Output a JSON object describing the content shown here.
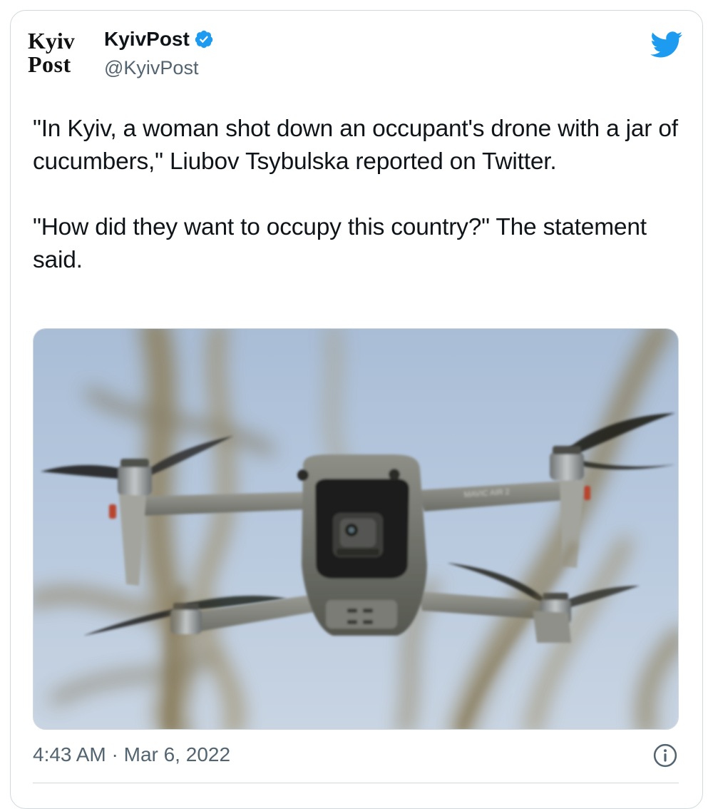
{
  "author": {
    "logo_line1": "Kyiv",
    "logo_line2": "Post",
    "display_name": "KyivPost",
    "handle": "@KyivPost",
    "verified": true
  },
  "tweet": {
    "paragraph1": "\"In Kyiv, a woman shot down an occupant's drone with a jar of cucumbers,\"  Liubov Tsybulska reported on Twitter.",
    "paragraph2": "\"How did they want to occupy this country?\" The statement said.",
    "timestamp": "4:43 AM · Mar 6, 2022"
  },
  "media": {
    "drone_label": "MAVIC AIR 2"
  },
  "icons": {
    "brand": "twitter-bird-icon",
    "verified": "verified-badge-icon",
    "info": "info-icon"
  },
  "colors": {
    "twitter_blue": "#1d9bf0",
    "text_primary": "#0f1419",
    "text_secondary": "#536471",
    "border": "#cfd9de"
  }
}
